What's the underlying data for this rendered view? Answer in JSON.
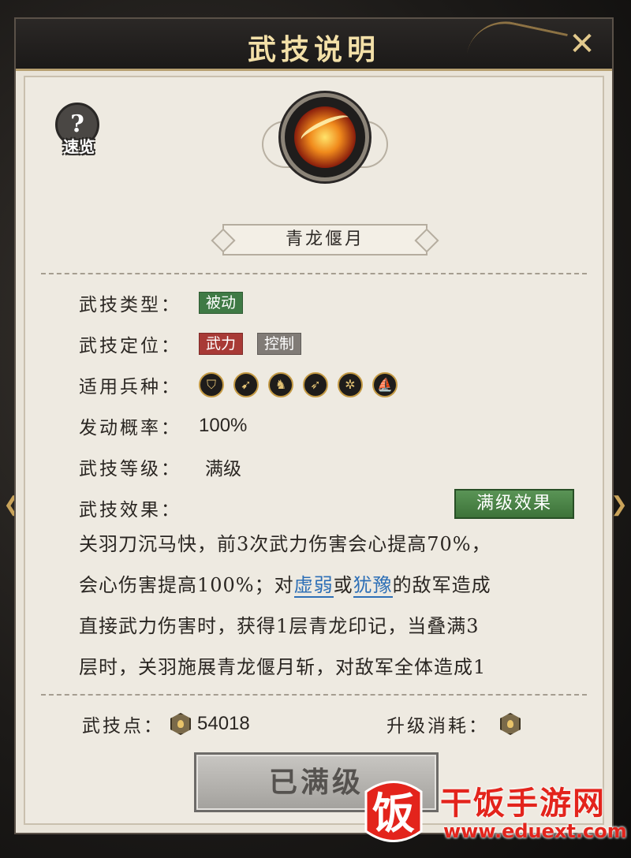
{
  "dialog": {
    "title": "武技说明",
    "close_icon": "close-crossed-swords-icon"
  },
  "help": {
    "icon": "question-head-icon",
    "label": "速览"
  },
  "skill": {
    "icon": "crescent-blade-skill-icon",
    "name": "青龙偃月"
  },
  "attributes": {
    "type_key": "武技类型：",
    "type_tags": [
      "被动"
    ],
    "position_key": "武技定位：",
    "position_tags": [
      "武力",
      "控制"
    ],
    "troops_key": "适用兵种：",
    "troop_icons": [
      "shield-troop-icon",
      "spear-troop-icon",
      "cavalry-troop-icon",
      "archer-troop-icon",
      "chariot-troop-icon",
      "navy-troop-icon"
    ],
    "rate_key": "发动概率：",
    "rate_value": "100%",
    "level_key": "武技等级：",
    "level_value": "满级",
    "effect_key": "武技效果："
  },
  "max_effect_button": "满级效果",
  "description": {
    "line1": "关羽刀沉马快，前3次武力伤害会心提高70%，",
    "line2_a": "会心伤害提高100%；对",
    "line2_hl1": "虚弱",
    "line2_b": "或",
    "line2_hl2": "犹豫",
    "line2_c": "的敌军造成",
    "line3": "直接武力伤害时，获得1层青龙印记，当叠满3",
    "line4": "层时，关羽施展青龙偃月斩，对敌军全体造成1"
  },
  "footer": {
    "points_key": "武技点：",
    "points_value": "54018",
    "cost_key": "升级消耗：",
    "cost_value": ""
  },
  "maxed_button": "已满级",
  "watermark": {
    "logo_char": "饭",
    "brand": "干饭手游网",
    "url": "www.eduext.com"
  },
  "colors": {
    "passive_tag": "#3f7a45",
    "force_tag": "#a83a36",
    "control_tag": "#807b76",
    "highlight_link": "#2d6fb6",
    "title_text": "#f3e0a8",
    "watermark": "#e3241c"
  }
}
